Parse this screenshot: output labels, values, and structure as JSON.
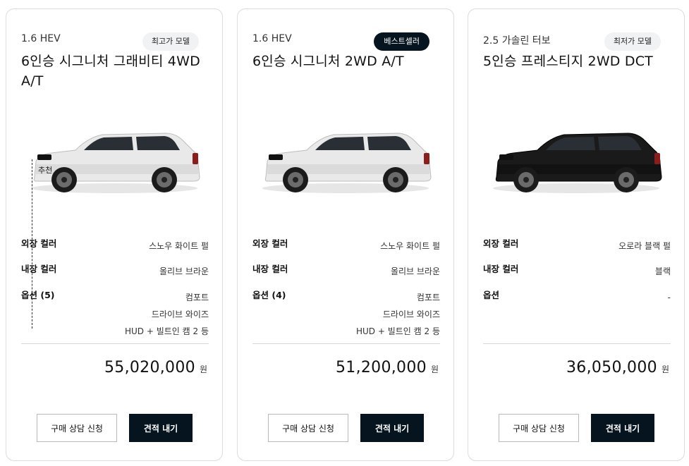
{
  "cards": [
    {
      "engine": "1.6 HEV",
      "badge": "최고가 모델",
      "badge_style": "light",
      "title": "6인승 시그니처 그래비티 4WD A/T",
      "car_color": "#e9e9e9",
      "specs": {
        "exterior_label": "외장 컬러",
        "exterior_value": "스노우 화이트 펄",
        "interior_label": "내장 컬러",
        "interior_value": "올리브 브라운",
        "options_label": "옵션 (5)",
        "options": [
          "컴포트",
          "드라이브 와이즈",
          "HUD + 빌트인 캠 2 등"
        ]
      },
      "price": "55,020,000",
      "price_unit": "원",
      "consult_button": "구매 상담 신청",
      "quote_button": "견적 내기",
      "overlay_label": "추천"
    },
    {
      "engine": "1.6 HEV",
      "badge": "베스트셀러",
      "badge_style": "dark",
      "title": "6인승 시그니처 2WD A/T",
      "car_color": "#e9e9e9",
      "specs": {
        "exterior_label": "외장 컬러",
        "exterior_value": "스노우 화이트 펄",
        "interior_label": "내장 컬러",
        "interior_value": "올리브 브라운",
        "options_label": "옵션 (4)",
        "options": [
          "컴포트",
          "드라이브 와이즈",
          "HUD + 빌트인 캠 2 등"
        ]
      },
      "price": "51,200,000",
      "price_unit": "원",
      "consult_button": "구매 상담 신청",
      "quote_button": "견적 내기"
    },
    {
      "engine": "2.5 가솔린 터보",
      "badge": "최저가 모델",
      "badge_style": "light",
      "title": "5인승 프레스티지 2WD DCT",
      "car_color": "#1a1a1a",
      "specs": {
        "exterior_label": "외장 컬러",
        "exterior_value": "오로라 블랙 펄",
        "interior_label": "내장 컬러",
        "interior_value": "블랙",
        "options_label": "옵션",
        "options": [
          "-"
        ]
      },
      "price": "36,050,000",
      "price_unit": "원",
      "consult_button": "구매 상담 신청",
      "quote_button": "견적 내기"
    }
  ]
}
